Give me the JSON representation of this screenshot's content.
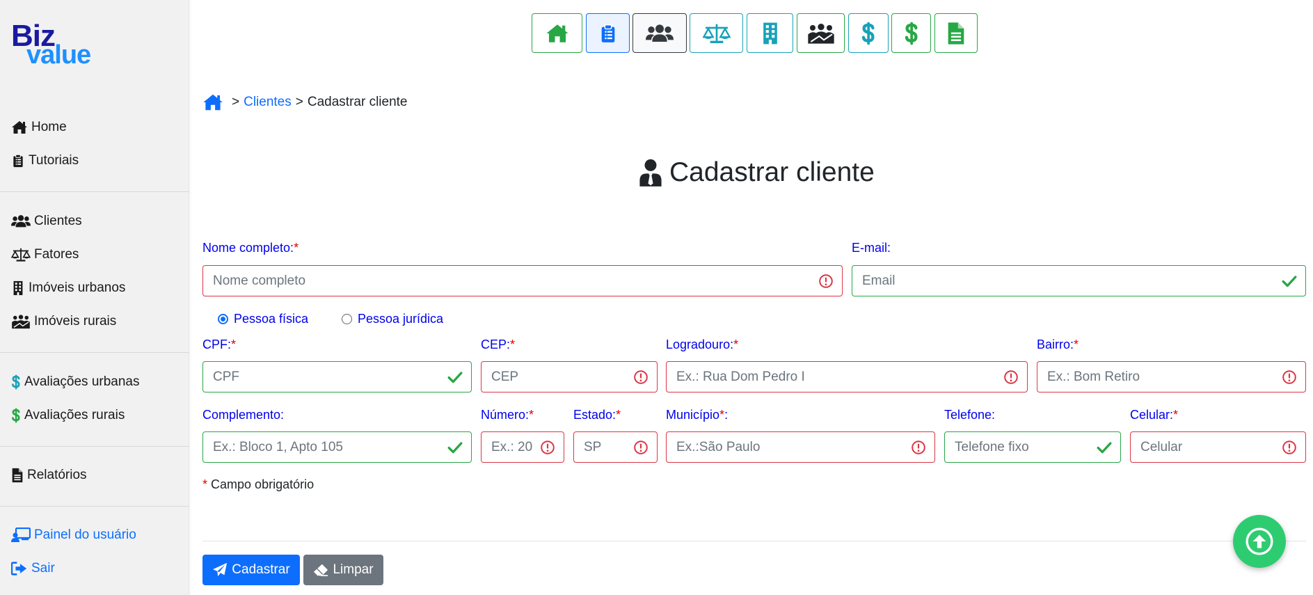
{
  "brand": {
    "line1": "Biz",
    "line2": "value"
  },
  "sidebar": {
    "items": [
      {
        "label": "Home",
        "icon": "home-icon"
      },
      {
        "label": "Tutoriais",
        "icon": "clipboard-icon"
      },
      {
        "label": "Clientes",
        "icon": "users-icon"
      },
      {
        "label": "Fatores",
        "icon": "balance-scale-icon"
      },
      {
        "label": "Imóveis urbanos",
        "icon": "building-icon"
      },
      {
        "label": "Imóveis rurais",
        "icon": "farm-icon"
      },
      {
        "label": "Avaliações urbanas",
        "icon": "dollar-icon"
      },
      {
        "label": "Avaliações rurais",
        "icon": "dollar-icon"
      },
      {
        "label": "Relatórios",
        "icon": "file-icon"
      },
      {
        "label": "Painel do usuário",
        "icon": "user-panel-icon"
      },
      {
        "label": "Sair",
        "icon": "sign-out-icon"
      }
    ]
  },
  "toolbar": {
    "buttons": [
      "home-icon",
      "clipboard-icon",
      "users-icon",
      "balance-scale-icon",
      "building-icon",
      "farm-icon",
      "dollar-icon",
      "dollar-icon",
      "file-icon"
    ]
  },
  "breadcrumb": {
    "sep": ">",
    "clientes": "Clientes",
    "current": "Cadastrar cliente"
  },
  "page_title": "Cadastrar cliente",
  "required_mark": "*",
  "form": {
    "nome": {
      "label": "Nome completo:",
      "placeholder": "Nome completo",
      "value": ""
    },
    "email": {
      "label": "E-mail:",
      "placeholder": "Email",
      "value": ""
    },
    "tipo": {
      "pf": "Pessoa física",
      "pj": "Pessoa jurídica",
      "selected": "Pessoa física"
    },
    "cpf": {
      "label": "CPF:",
      "placeholder": "CPF",
      "value": ""
    },
    "cep": {
      "label": "CEP:",
      "placeholder": "CEP",
      "value": ""
    },
    "logradouro": {
      "label": "Logradouro:",
      "placeholder": "Ex.: Rua Dom Pedro I",
      "value": ""
    },
    "bairro": {
      "label": "Bairro:",
      "placeholder": "Ex.: Bom Retiro",
      "value": ""
    },
    "complemento": {
      "label": "Complemento:",
      "placeholder": "Ex.: Bloco 1, Apto 105",
      "value": ""
    },
    "numero": {
      "label": "Número:",
      "placeholder": "Ex.: 20",
      "value": ""
    },
    "estado": {
      "label": "Estado:",
      "placeholder": "SP",
      "value": ""
    },
    "municipio": {
      "label": "Município",
      "suffix": ":",
      "placeholder": "Ex.:São Paulo",
      "value": ""
    },
    "telefone": {
      "label": "Telefone:",
      "placeholder": "Telefone fixo",
      "value": ""
    },
    "celular": {
      "label": "Celular:",
      "placeholder": "Celular",
      "value": ""
    }
  },
  "note": "Campo obrigatório",
  "buttons": {
    "submit": "Cadastrar",
    "clear": "Limpar"
  },
  "colors": {
    "primary": "#0d6efd",
    "success": "#28a745",
    "danger": "#dc3545",
    "info": "#17a2b8",
    "label": "#0000ee",
    "scrolltop": "#2ecc71"
  }
}
